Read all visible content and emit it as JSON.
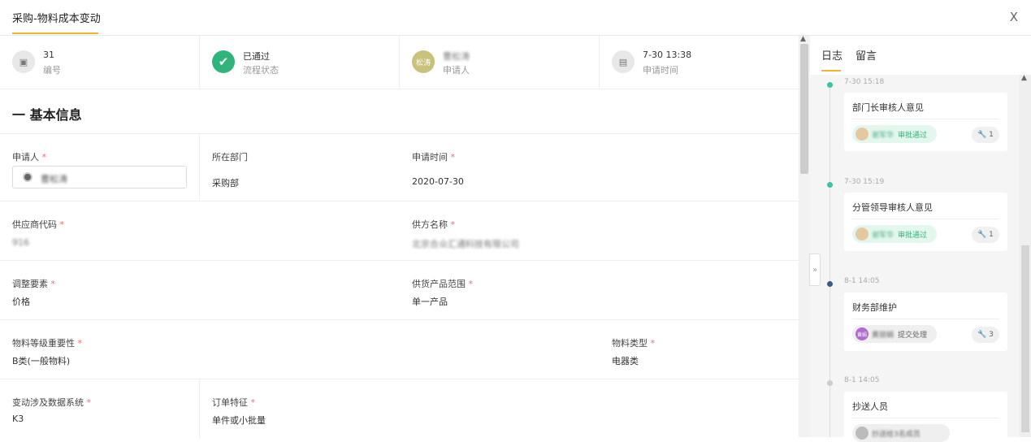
{
  "header": {
    "tab_title": "采购-物料成本变动",
    "close_label": "X"
  },
  "summary": {
    "number_value": "31",
    "number_label": "编号",
    "status_value": "已通过",
    "status_label": "流程状态",
    "applicant_avatar": "松涛",
    "applicant_value": "曹松涛",
    "applicant_label": "申请人",
    "time_value": "7-30 13:38",
    "time_label": "申请时间"
  },
  "section": {
    "title": "一 基本信息"
  },
  "form": {
    "applicant_label": "申请人",
    "applicant_value": "曹松涛",
    "dept_label": "所在部门",
    "dept_value": "采购部",
    "apply_time_label": "申请时间",
    "apply_time_value": "2020-07-30",
    "supplier_code_label": "供应商代码",
    "supplier_code_value": "916",
    "supplier_name_label": "供方名称",
    "supplier_name_value": "北京合众汇通科技有限公司",
    "adjust_label": "调整要素",
    "adjust_value": "价格",
    "supply_range_label": "供货产品范围",
    "supply_range_value": "单一产品",
    "importance_label": "物料等级重要性",
    "importance_value": "B类(一般物料)",
    "material_type_label": "物料类型",
    "material_type_value": "电器类",
    "system_label": "变动涉及数据系统",
    "system_value": "K3",
    "order_label": "订单特征",
    "order_value": "单件或小批量"
  },
  "sidebar": {
    "tab_log": "日志",
    "tab_comment": "留言",
    "entries": [
      {
        "time": "7-30 15:18",
        "title": "部门长审核人意见",
        "person": "谢军华",
        "action": "审批通过",
        "count": "1"
      },
      {
        "time": "7-30 15:19",
        "title": "分管领导审核人意见",
        "person": "谢军华",
        "action": "审批通过",
        "count": "1"
      },
      {
        "time": "8-1 14:05",
        "title": "财务部维护",
        "person": "黄丽娟",
        "avatar": "黄娟",
        "action": "提交处理",
        "count": "3"
      },
      {
        "time": "8-1 14:05",
        "title": "抄送人员",
        "person": "抄送给3名成员"
      }
    ]
  },
  "colors": {
    "accent": "#f2b233",
    "success": "#3bb07a",
    "required": "#f56c6c"
  }
}
